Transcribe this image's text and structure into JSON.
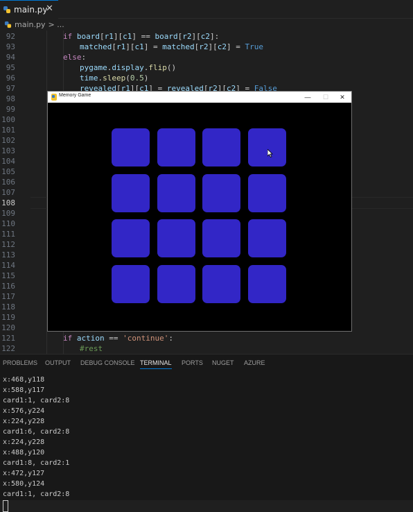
{
  "tab": {
    "filename": "main.py",
    "close_glyph": "✕"
  },
  "breadcrumb": {
    "file": "main.py",
    "sep": "> ..."
  },
  "editor": {
    "active_line": "108",
    "lines": [
      {
        "n": "92",
        "tokens": [
          {
            "t": "if ",
            "c": "k"
          },
          {
            "t": "board",
            "c": "v"
          },
          {
            "t": "[",
            "c": "p"
          },
          {
            "t": "r1",
            "c": "v"
          },
          {
            "t": "][",
            "c": "p"
          },
          {
            "t": "c1",
            "c": "v"
          },
          {
            "t": "] == ",
            "c": "p"
          },
          {
            "t": "board",
            "c": "v"
          },
          {
            "t": "[",
            "c": "p"
          },
          {
            "t": "r2",
            "c": "v"
          },
          {
            "t": "][",
            "c": "p"
          },
          {
            "t": "c2",
            "c": "v"
          },
          {
            "t": "]:",
            "c": "p"
          }
        ],
        "indent": 0
      },
      {
        "n": "93",
        "tokens": [
          {
            "t": "matched",
            "c": "v"
          },
          {
            "t": "[",
            "c": "p"
          },
          {
            "t": "r1",
            "c": "v"
          },
          {
            "t": "][",
            "c": "p"
          },
          {
            "t": "c1",
            "c": "v"
          },
          {
            "t": "] = ",
            "c": "p"
          },
          {
            "t": "matched",
            "c": "v"
          },
          {
            "t": "[",
            "c": "p"
          },
          {
            "t": "r2",
            "c": "v"
          },
          {
            "t": "][",
            "c": "p"
          },
          {
            "t": "c2",
            "c": "v"
          },
          {
            "t": "] = ",
            "c": "p"
          },
          {
            "t": "True",
            "c": "c"
          }
        ],
        "indent": 1
      },
      {
        "n": "94",
        "tokens": [
          {
            "t": "else",
            "c": "k"
          },
          {
            "t": ":",
            "c": "p"
          }
        ],
        "indent": 0
      },
      {
        "n": "95",
        "tokens": [
          {
            "t": "pygame",
            "c": "v"
          },
          {
            "t": ".",
            "c": "p"
          },
          {
            "t": "display",
            "c": "v"
          },
          {
            "t": ".",
            "c": "p"
          },
          {
            "t": "flip",
            "c": "f"
          },
          {
            "t": "()",
            "c": "p"
          }
        ],
        "indent": 1
      },
      {
        "n": "96",
        "tokens": [
          {
            "t": "time",
            "c": "v"
          },
          {
            "t": ".",
            "c": "p"
          },
          {
            "t": "sleep",
            "c": "f"
          },
          {
            "t": "(",
            "c": "p"
          },
          {
            "t": "0.5",
            "c": "n"
          },
          {
            "t": ")",
            "c": "p"
          }
        ],
        "indent": 1
      },
      {
        "n": "97",
        "tokens": [
          {
            "t": "revealed",
            "c": "v"
          },
          {
            "t": "[",
            "c": "p"
          },
          {
            "t": "r1",
            "c": "v"
          },
          {
            "t": "][",
            "c": "p"
          },
          {
            "t": "c1",
            "c": "v"
          },
          {
            "t": "] = ",
            "c": "p"
          },
          {
            "t": "revealed",
            "c": "v"
          },
          {
            "t": "[",
            "c": "p"
          },
          {
            "t": "r2",
            "c": "v"
          },
          {
            "t": "][",
            "c": "p"
          },
          {
            "t": "c2",
            "c": "v"
          },
          {
            "t": "] = ",
            "c": "p"
          },
          {
            "t": "False",
            "c": "c"
          }
        ],
        "indent": 1
      },
      {
        "n": "98",
        "tokens": [],
        "indent": 0
      },
      {
        "n": "99",
        "tokens": [],
        "indent": 0
      },
      {
        "n": "100",
        "tokens": [],
        "indent": 0
      },
      {
        "n": "101",
        "tokens": [],
        "indent": 0
      },
      {
        "n": "102",
        "tokens": [],
        "indent": 0
      },
      {
        "n": "103",
        "tokens": [],
        "indent": 0
      },
      {
        "n": "104",
        "tokens": [],
        "indent": 0
      },
      {
        "n": "105",
        "tokens": [],
        "indent": 0
      },
      {
        "n": "106",
        "tokens": [],
        "indent": 0
      },
      {
        "n": "107",
        "tokens": [],
        "indent": 0
      },
      {
        "n": "108",
        "tokens": [],
        "indent": 0
      },
      {
        "n": "109",
        "tokens": [],
        "indent": 0
      },
      {
        "n": "110",
        "tokens": [],
        "indent": 0
      },
      {
        "n": "111",
        "tokens": [],
        "indent": 0
      },
      {
        "n": "112",
        "tokens": [],
        "indent": 0
      },
      {
        "n": "113",
        "tokens": [],
        "indent": 0
      },
      {
        "n": "114",
        "tokens": [],
        "indent": 0
      },
      {
        "n": "115",
        "tokens": [],
        "indent": 0
      },
      {
        "n": "116",
        "tokens": [],
        "indent": 0
      },
      {
        "n": "117",
        "tokens": [],
        "indent": 0
      },
      {
        "n": "118",
        "tokens": [],
        "indent": 0
      },
      {
        "n": "119",
        "tokens": [],
        "indent": 0
      },
      {
        "n": "120",
        "tokens": [],
        "indent": 0
      },
      {
        "n": "121",
        "tokens": [
          {
            "t": "if ",
            "c": "k"
          },
          {
            "t": "action",
            "c": "v"
          },
          {
            "t": " == ",
            "c": "p"
          },
          {
            "t": "'continue'",
            "c": "s"
          },
          {
            "t": ":",
            "c": "p"
          }
        ],
        "indent": 0
      },
      {
        "n": "122",
        "tokens": [
          {
            "t": "#rest",
            "c": "cm"
          }
        ],
        "indent": 1
      }
    ]
  },
  "game_window": {
    "title": "Memory Game",
    "min_glyph": "—",
    "max_glyph": "☐",
    "close_glyph": "✕",
    "card_color": "#3226c6",
    "rows": 4,
    "cols": 4
  },
  "panel": {
    "tabs": [
      "PROBLEMS",
      "OUTPUT",
      "DEBUG CONSOLE",
      "TERMINAL",
      "PORTS",
      "NUGET",
      "AZURE"
    ],
    "active_tab": "TERMINAL",
    "terminal_lines": [
      "x:468,y118",
      "x:588,y117",
      "card1:1, card2:8",
      "x:576,y224",
      "x:224,y228",
      "card1:6, card2:8",
      "x:224,y228",
      "x:488,y120",
      "card1:8, card2:1",
      "x:472,y127",
      "x:580,y124",
      "card1:1, card2:8"
    ]
  }
}
